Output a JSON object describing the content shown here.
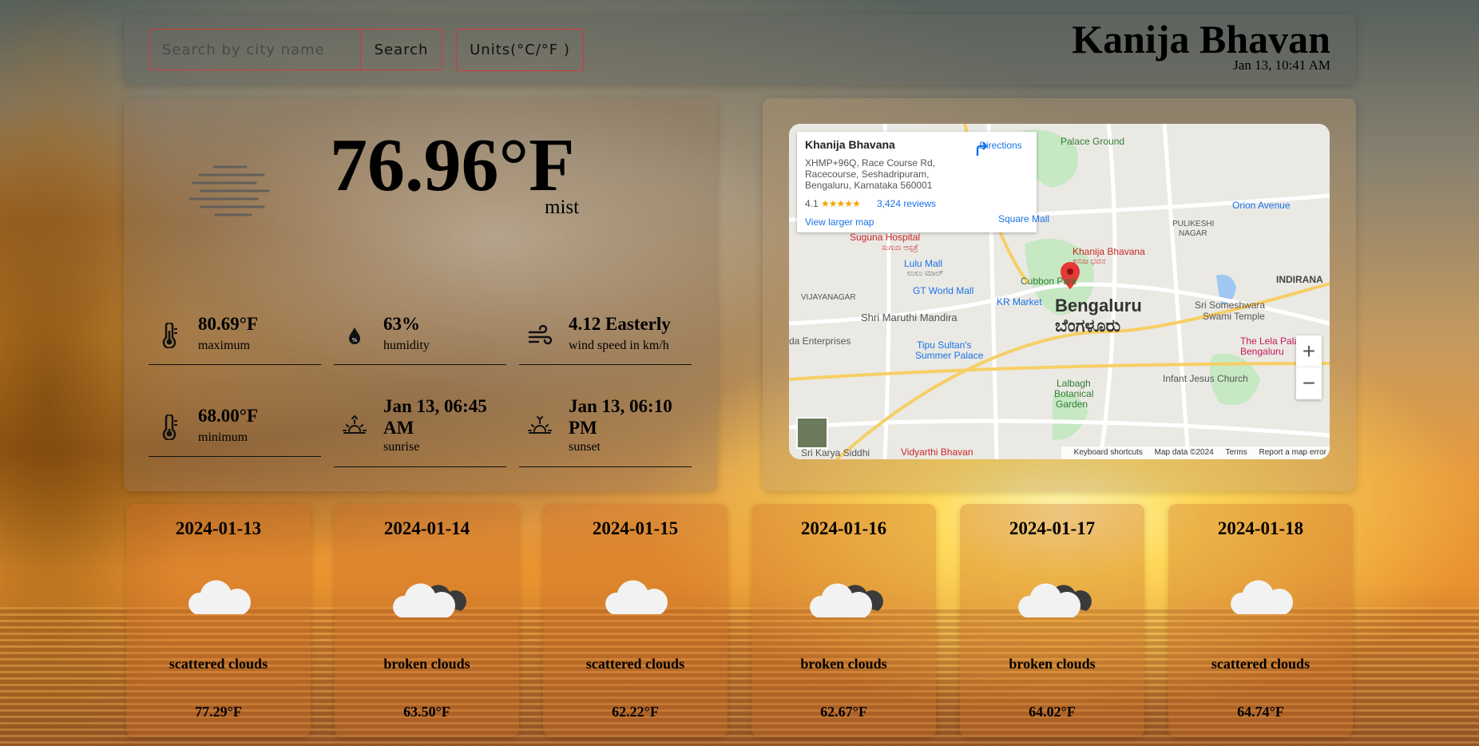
{
  "header": {
    "search_placeholder": "Search by city name",
    "search_label": "Search",
    "units_label": "Units(°C/°F )",
    "city": "Kanija Bhavan",
    "datetime": "Jan 13, 10:41 AM"
  },
  "current": {
    "temp": "76.96°F",
    "description": "mist",
    "icon": "mist-icon",
    "stats": [
      {
        "icon": "thermometer-icon",
        "value": "80.69°F",
        "label": "maximum"
      },
      {
        "icon": "humidity-drop-icon",
        "value": "63%",
        "label": "humidity"
      },
      {
        "icon": "wind-icon",
        "value": "4.12 Easterly",
        "label": "wind speed in km/h"
      },
      {
        "icon": "thermometer-icon",
        "value": "68.00°F",
        "label": "minimum"
      },
      {
        "icon": "sunrise-icon",
        "value": "Jan 13, 06:45 AM",
        "label": "sunrise"
      },
      {
        "icon": "sunset-icon",
        "value": "Jan 13, 06:10 PM",
        "label": "sunset"
      }
    ]
  },
  "map": {
    "place_name": "Khanija Bhavana",
    "address": "XHMP+96Q, Race Course Rd, Racecourse, Seshadripuram, Bengaluru, Karnataka 560001",
    "rating": "4.1",
    "stars": "★★★★★",
    "reviews": "3,424 reviews",
    "view_larger": "View larger map",
    "directions": "Directions",
    "labels": {
      "palace_ground": "Palace Ground",
      "suguna": "Suguna Hospital",
      "suguna_kn": "ಸುಗುಣ ಆಸ್ಪತ್ರೆ",
      "lulu": "Lulu Mall",
      "lulu_kn": "ಲುಲು ಮಾಲ್",
      "gt_world": "GT World Mall",
      "cubbon": "Cubbon Park",
      "kr_market": "KR Market",
      "shri_maruthi": "Shri Maruthi Mandira",
      "tipu": "Tipu Sultan's",
      "tipu2": "Summer Palace",
      "bengaluru": "Bengaluru",
      "bengaluru_kn": "ಬೆಂಗಳೂರು",
      "orion": "Orion Avenue",
      "sri_someshwara": "Sri Someshwara",
      "swami_temple": "Swami Temple",
      "infant_jesus": "Infant Jesus Church",
      "indirana": "INDIRANA",
      "marker": "Khanija Bhavana",
      "marker_kn": "ಖನಿಜ ಭವನ",
      "square_mall": "Square Mall",
      "vidyarthi": "Vidyarthi Bhavan",
      "lalbagh": "Lalbagh",
      "botanical": "Botanical",
      "garden": "Garden",
      "vijayanagar": "VIJAYANAGAR",
      "enterprises": "da Enterprises",
      "sri_karya": "Sri Karya Siddhi",
      "lake": "The Lela Palace",
      "bengaluru_small": "Bengaluru",
      "pulikeshi": "PULIKESHI",
      "nagar": "NAGAR"
    },
    "footer": [
      "Keyboard shortcuts",
      "Map data ©2024",
      "Terms",
      "Report a map error"
    ]
  },
  "forecast": [
    {
      "date": "2024-01-13",
      "icon": "scattered-clouds-icon",
      "desc": "scattered clouds",
      "temp": "77.29°F"
    },
    {
      "date": "2024-01-14",
      "icon": "broken-clouds-icon",
      "desc": "broken clouds",
      "temp": "63.50°F"
    },
    {
      "date": "2024-01-15",
      "icon": "scattered-clouds-icon",
      "desc": "scattered clouds",
      "temp": "62.22°F"
    },
    {
      "date": "2024-01-16",
      "icon": "broken-clouds-icon",
      "desc": "broken clouds",
      "temp": "62.67°F"
    },
    {
      "date": "2024-01-17",
      "icon": "broken-clouds-icon",
      "desc": "broken clouds",
      "temp": "64.02°F"
    },
    {
      "date": "2024-01-18",
      "icon": "scattered-clouds-icon",
      "desc": "scattered clouds",
      "temp": "64.74°F"
    }
  ]
}
